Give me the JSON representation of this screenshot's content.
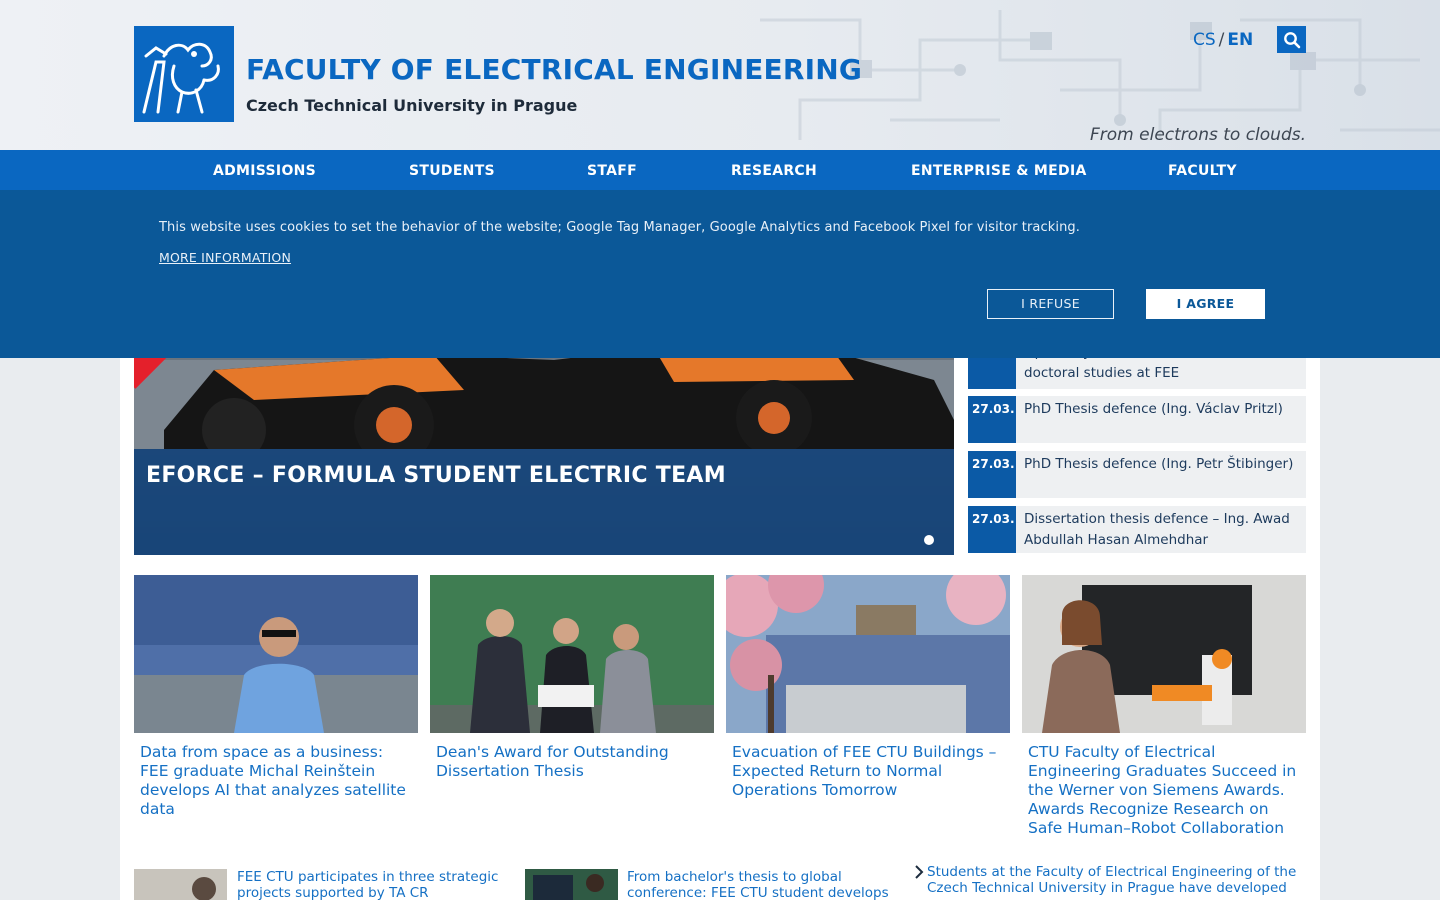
{
  "header": {
    "faculty_title": "FACULTY OF ELECTRICAL ENGINEERING",
    "university": "Czech Technical University in Prague",
    "tagline": "From electrons to clouds.",
    "lang_cs": "CS",
    "lang_sep": "/",
    "lang_en": "EN"
  },
  "nav": {
    "items": [
      {
        "label": "ADMISSIONS"
      },
      {
        "label": "STUDENTS"
      },
      {
        "label": "STAFF"
      },
      {
        "label": "RESEARCH"
      },
      {
        "label": "ENTERPRISE & MEDIA"
      },
      {
        "label": "FACULTY"
      }
    ]
  },
  "cookie": {
    "message": "This website uses cookies to set the behavior of the website; Google Tag Manager, Google Analytics and Facebook Pixel for visitor tracking.",
    "more_info": "MORE INFORMATION",
    "refuse": "I REFUSE",
    "agree": "I AGREE"
  },
  "slider": {
    "caption": "EFORCE – FORMULA STUDENT ELECTRIC TEAM"
  },
  "events": [
    {
      "date": "",
      "title": "Open Day for those interested in doctoral studies at FEE"
    },
    {
      "date": "27.03.",
      "title": "PhD Thesis defence (Ing. Václav Pritzl)"
    },
    {
      "date": "27.03.",
      "title": "PhD Thesis defence (Ing. Petr Štibinger)"
    },
    {
      "date": "27.03.",
      "title": "Dissertation thesis defence – Ing. Awad Abdullah Hasan Almehdhar"
    }
  ],
  "news": [
    {
      "title": "Data from space as a business: FEE graduate Michal Reinštein develops AI that analyzes satellite data"
    },
    {
      "title": "Dean's Award for Outstanding Dissertation Thesis"
    },
    {
      "title": "Evacuation of FEE CTU Buildings – Expected Return to Normal Operations Tomorrow"
    },
    {
      "title": "CTU Faculty of Electrical Engineering Graduates Succeed in the Werner von Siemens Awards. Awards Recognize Research on Safe Human–Robot Collaboration"
    }
  ],
  "more_news": [
    {
      "title": "FEE CTU participates in three strategic projects supported by TA CR"
    },
    {
      "title": "From bachelor's thesis to global conference: FEE CTU student develops"
    },
    {
      "title": "Students at the Faculty of Electrical Engineering of the Czech Technical University in Prague have developed"
    }
  ],
  "colors": {
    "brand_blue": "#0a67c1",
    "cookie_bg": "#0b5898",
    "link_blue": "#1570c4"
  }
}
